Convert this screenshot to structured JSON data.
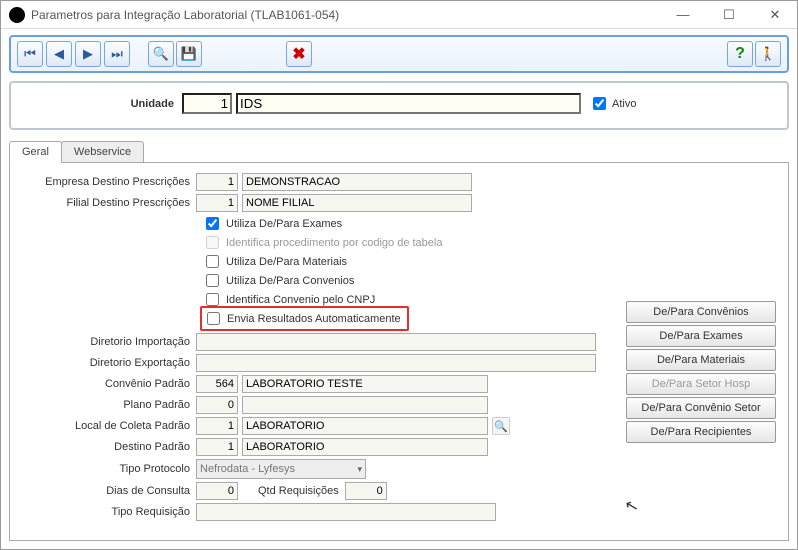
{
  "window": {
    "title": "Parametros para Integração Laboratorial (TLAB1061-054)"
  },
  "unit": {
    "label": "Unidade",
    "code": "1",
    "desc": "IDS",
    "active_label": "Ativo",
    "active": true
  },
  "tabs": {
    "general": "Geral",
    "webservice": "Webservice"
  },
  "form": {
    "empresa_label": "Empresa Destino Prescrições",
    "empresa_code": "1",
    "empresa_desc": "DEMONSTRACAO",
    "filial_label": "Filial Destino Prescrições",
    "filial_code": "1",
    "filial_desc": "NOME FILIAL",
    "chk_depara_exames": "Utiliza De/Para Exames",
    "chk_ident_proc": "Identifica procedimento por codigo de tabela",
    "chk_depara_materiais": "Utiliza De/Para Materiais",
    "chk_depara_convenios": "Utiliza De/Para Convenios",
    "chk_ident_cnpj": "Identifica Convenio pelo CNPJ",
    "chk_envia_auto": "Envia Resultados Automaticamente",
    "dir_import_label": "Diretorio Importação",
    "dir_export_label": "Diretorio Exportação",
    "convenio_label": "Convênio Padrão",
    "convenio_code": "564",
    "convenio_desc": "LABORATORIO TESTE",
    "plano_label": "Plano Padrão",
    "plano_code": "0",
    "local_label": "Local de Coleta Padrão",
    "local_code": "1",
    "local_desc": "LABORATORIO",
    "destino_label": "Destino Padrão",
    "destino_code": "1",
    "destino_desc": "LABORATORIO",
    "tipo_protocolo_label": "Tipo Protocolo",
    "tipo_protocolo_value": "Nefrodata - Lyfesys",
    "dias_consulta_label": "Dias de Consulta",
    "dias_consulta_value": "0",
    "qtd_req_label": "Qtd Requisições",
    "qtd_req_value": "0",
    "tipo_req_label": "Tipo Requisição"
  },
  "sidebuttons": {
    "convenios": "De/Para Convênios",
    "exames": "De/Para Exames",
    "materiais": "De/Para Materiais",
    "setor_hosp": "De/Para Setor Hosp",
    "convenio_setor": "De/Para Convênio Setor",
    "recipientes": "De/Para Recipientes"
  }
}
